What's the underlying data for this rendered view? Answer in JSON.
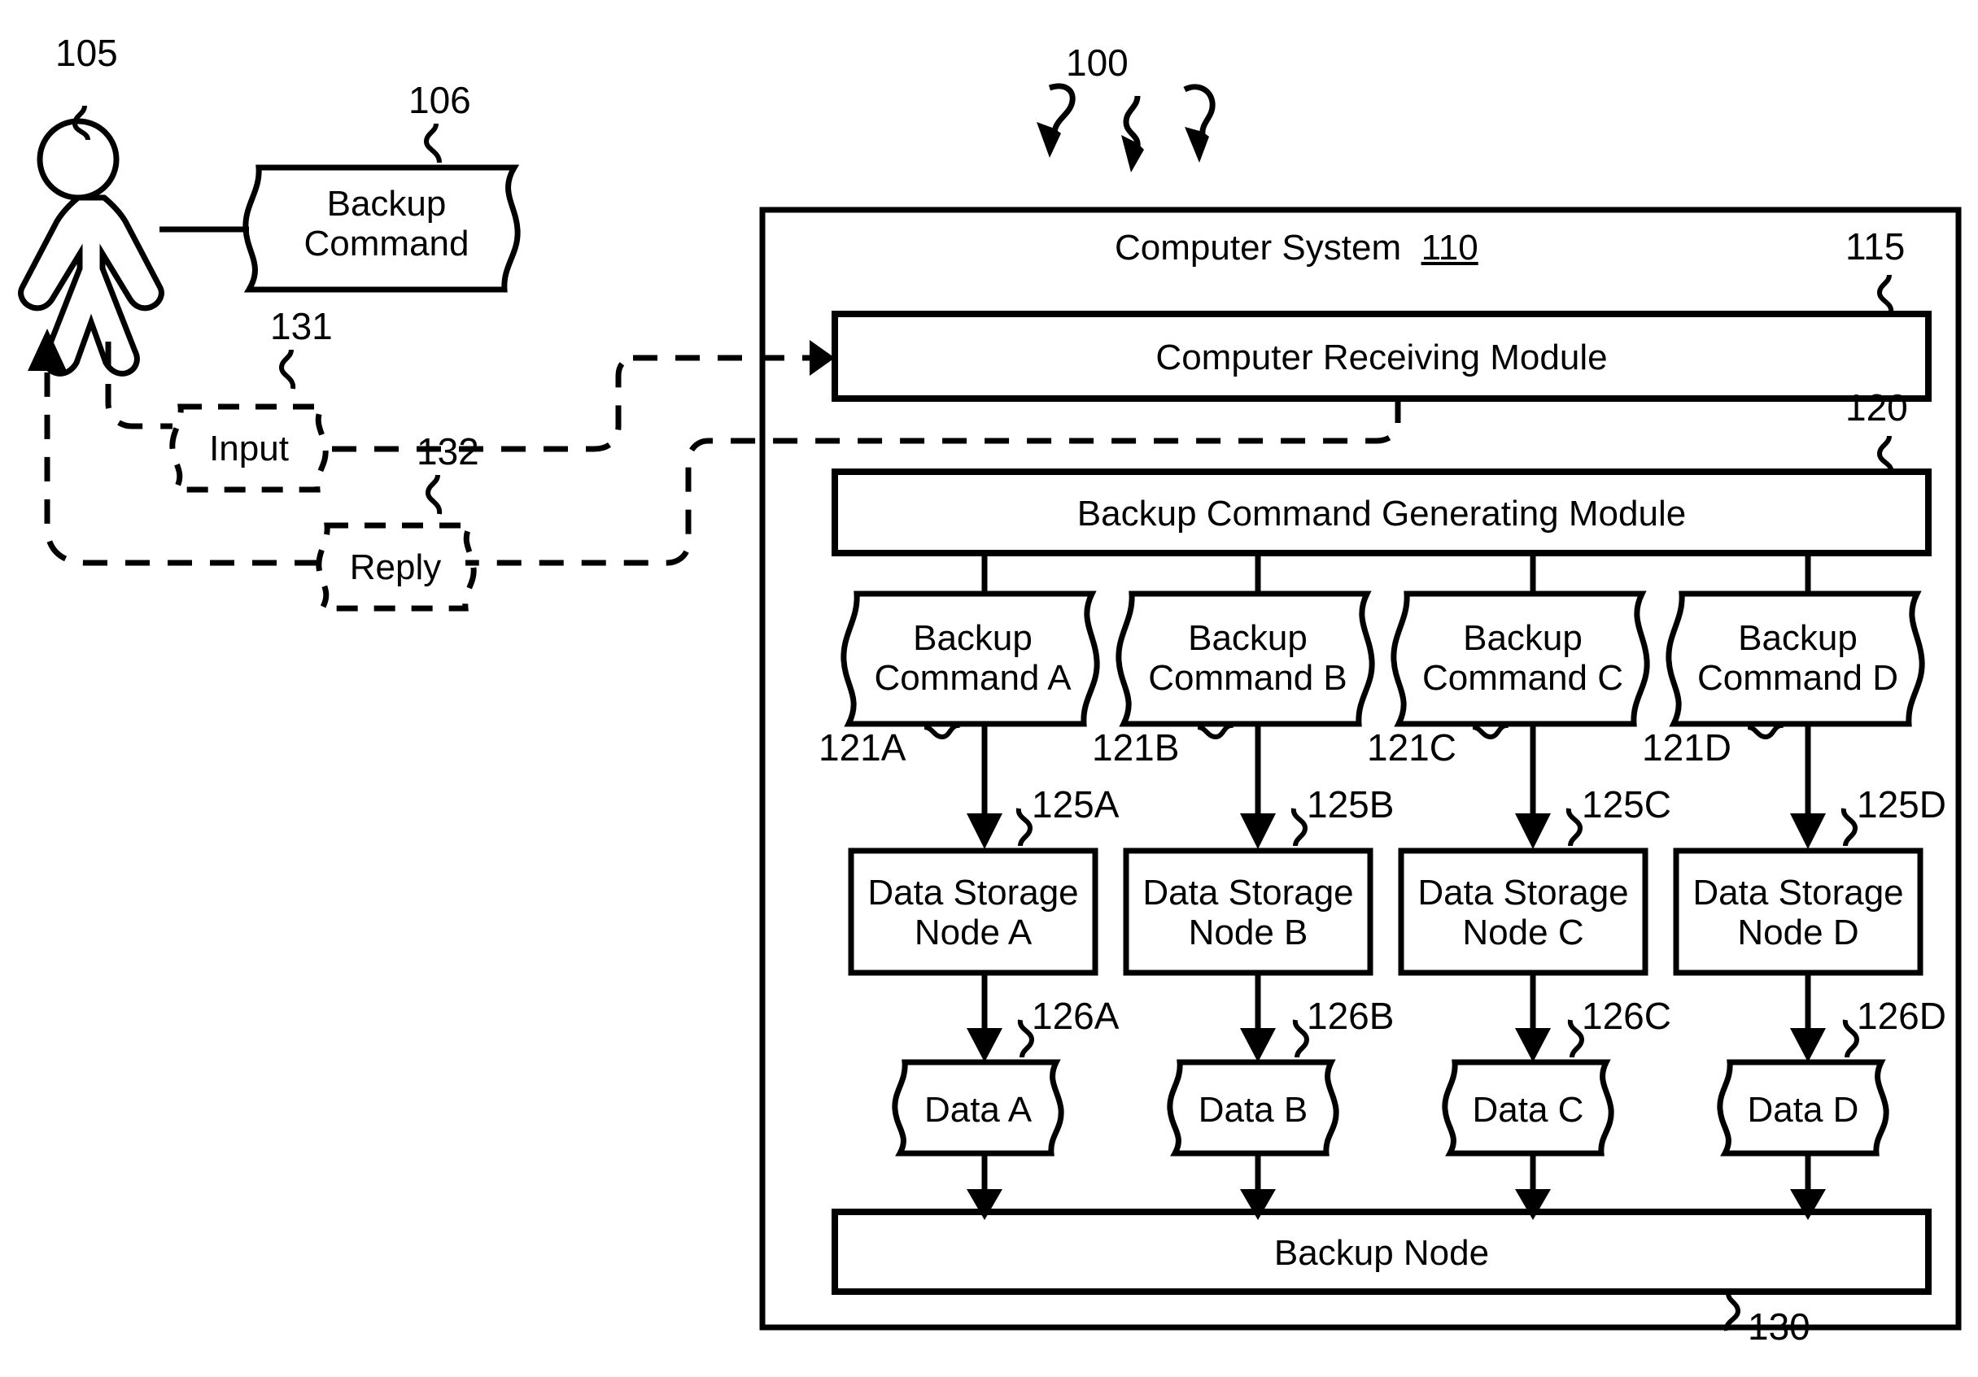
{
  "figure": {
    "figure_ref": "100",
    "actor": {
      "ref": "105",
      "icon": "person-icon"
    },
    "user_backup_command": {
      "label_line1": "Backup",
      "label_line2": "Command",
      "ref": "106"
    },
    "input_doc": {
      "label": "Input",
      "ref": "131"
    },
    "reply_doc": {
      "label": "Reply",
      "ref": "132"
    },
    "computer_system": {
      "title": "Computer System",
      "ref": "110",
      "receiving_module": {
        "label": "Computer Receiving Module",
        "ref": "115"
      },
      "generating_module": {
        "label": "Backup Command Generating Module",
        "ref": "120"
      },
      "backup_commands": [
        {
          "line1": "Backup",
          "line2": "Command A",
          "ref": "121A"
        },
        {
          "line1": "Backup",
          "line2": "Command B",
          "ref": "121B"
        },
        {
          "line1": "Backup",
          "line2": "Command C",
          "ref": "121C"
        },
        {
          "line1": "Backup",
          "line2": "Command D",
          "ref": "121D"
        }
      ],
      "storage_nodes": [
        {
          "line1": "Data Storage",
          "line2": "Node A",
          "ref": "125A"
        },
        {
          "line1": "Data Storage",
          "line2": "Node B",
          "ref": "125B"
        },
        {
          "line1": "Data Storage",
          "line2": "Node C",
          "ref": "125C"
        },
        {
          "line1": "Data Storage",
          "line2": "Node D",
          "ref": "125D"
        }
      ],
      "data_docs": [
        {
          "label": "Data A",
          "ref": "126A"
        },
        {
          "label": "Data B",
          "ref": "126B"
        },
        {
          "label": "Data C",
          "ref": "126C"
        },
        {
          "label": "Data D",
          "ref": "126D"
        }
      ],
      "backup_node": {
        "label": "Backup Node",
        "ref": "130"
      }
    },
    "colors": {
      "stroke": "#000000",
      "background": "#ffffff"
    }
  }
}
